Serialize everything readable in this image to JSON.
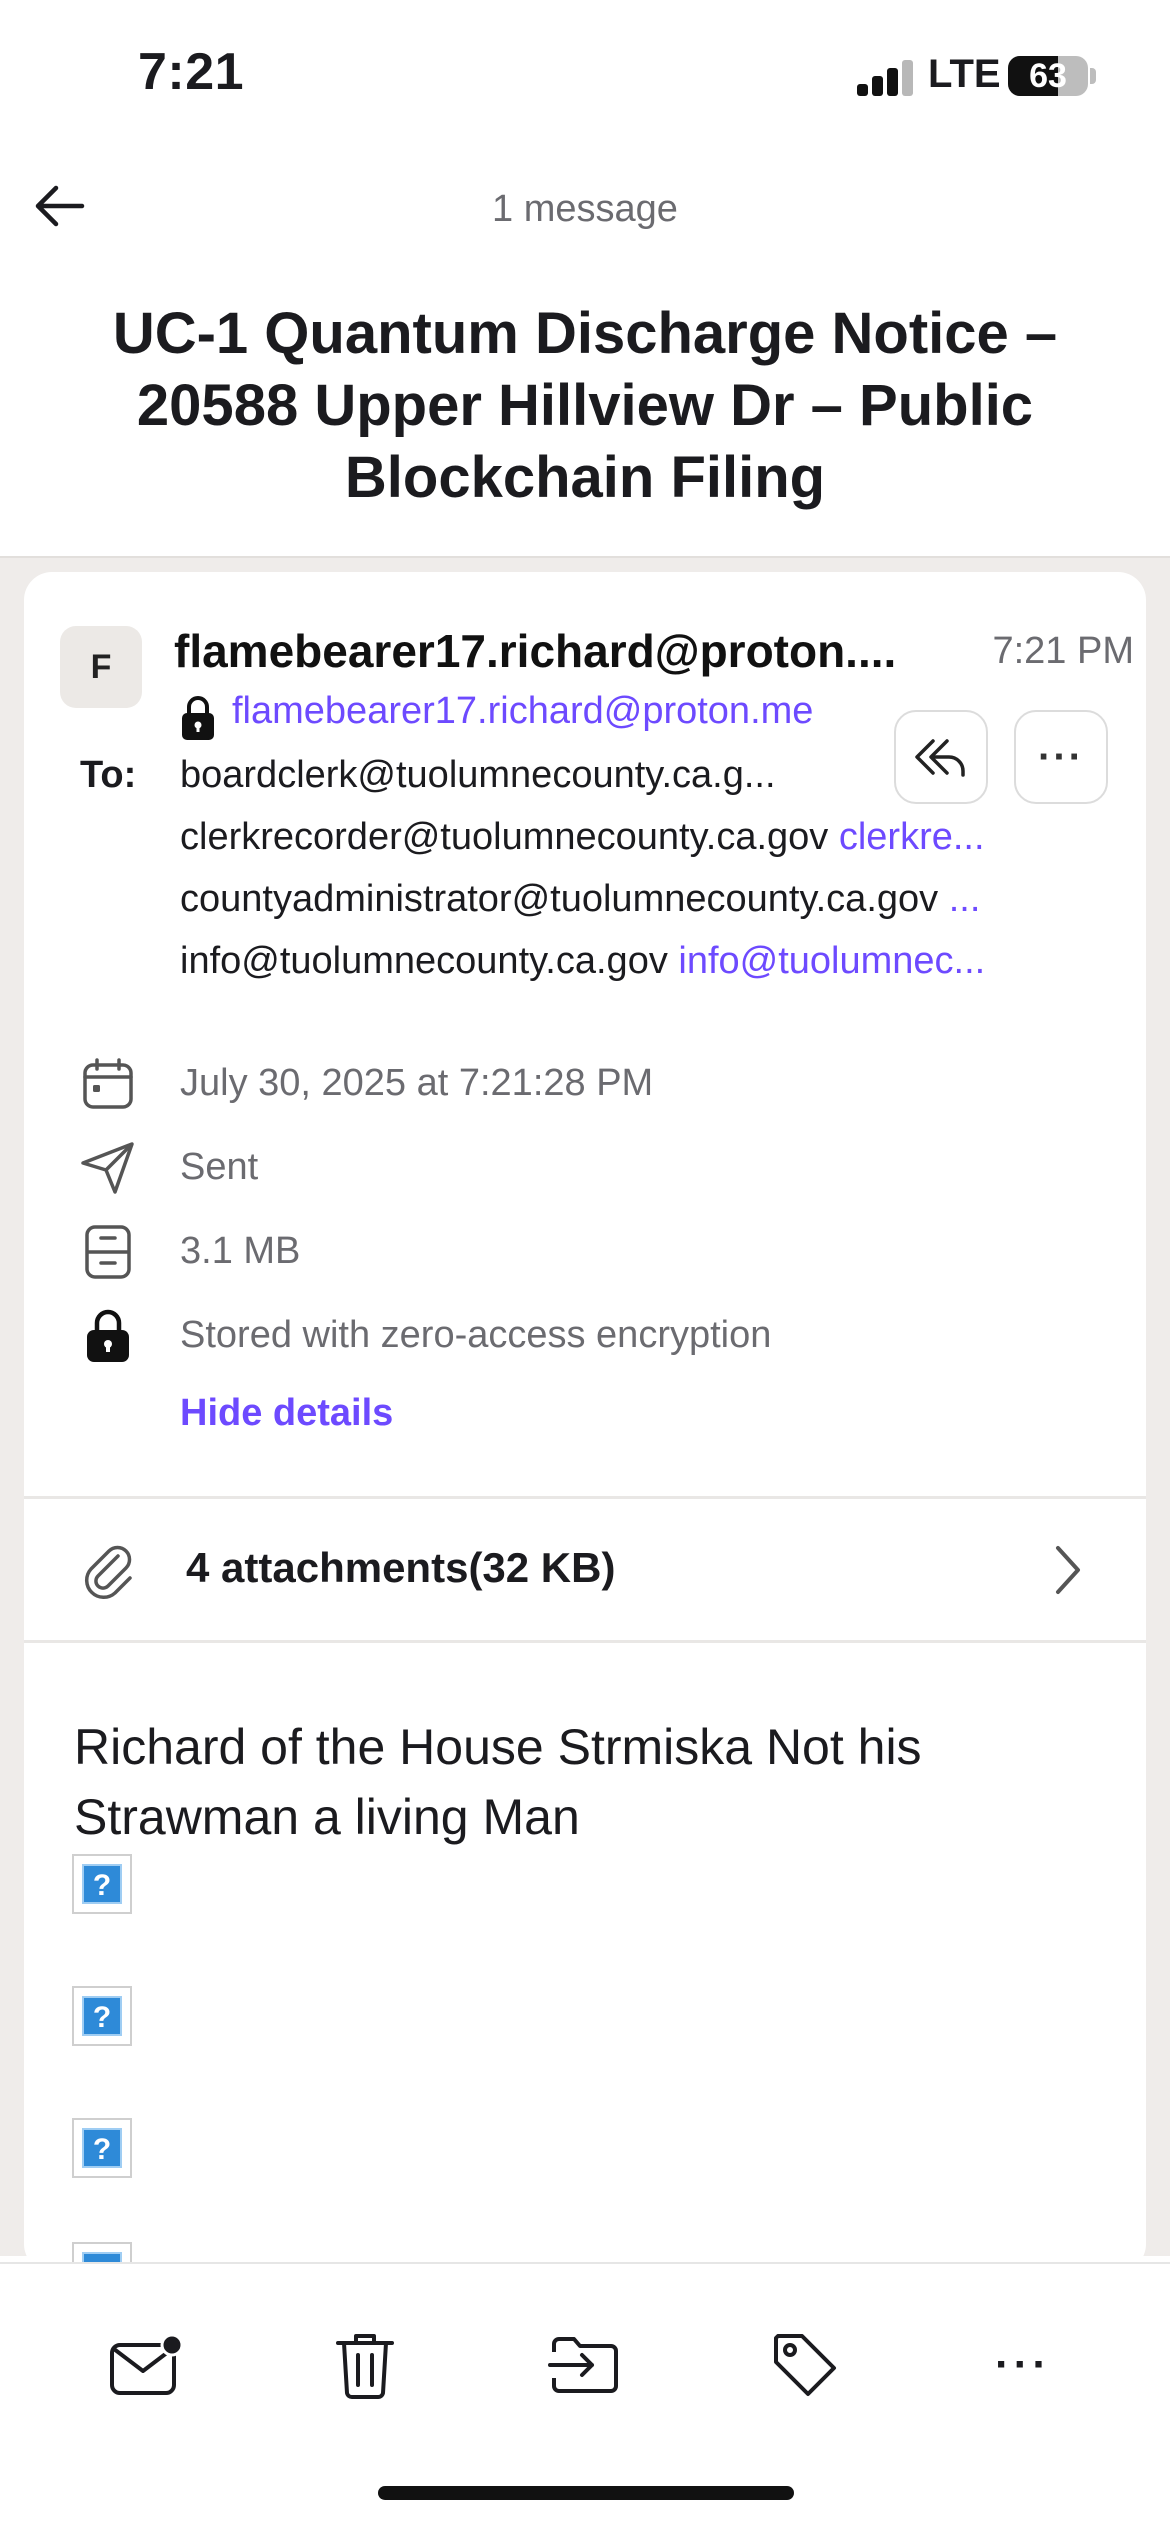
{
  "status_bar": {
    "time": "7:21",
    "network": "LTE",
    "battery": "63"
  },
  "header": {
    "message_count": "1 message",
    "subject": "UC-1 Quantum Discharge Notice – 20588 Upper Hillview Dr – Public Blockchain Filing"
  },
  "message": {
    "avatar_initial": "F",
    "sender_name": "flamebearer17.richard@proton....",
    "sender_address": "flamebearer17.richard@proton.me",
    "time": "7:21 PM",
    "to_label": "To:",
    "recipients": [
      {
        "address": "boardclerk@tuolumnecounty.ca.g...",
        "alt": ""
      },
      {
        "address": "clerkrecorder@tuolumnecounty.ca.gov",
        "alt": "clerkre..."
      },
      {
        "address": "countyadministrator@tuolumnecounty.ca.gov",
        "alt": "..."
      },
      {
        "address": "info@tuolumnecounty.ca.gov",
        "alt": "info@tuolumnec..."
      }
    ],
    "more_label": "···",
    "details": {
      "date": "July 30, 2025 at 7:21:28 PM",
      "folder": "Sent",
      "size": "3.1 MB",
      "encryption": "Stored with zero-access encryption",
      "hide_details": "Hide details"
    },
    "attachments": {
      "count_text": "4 attachments",
      "size_text": "(32 KB)"
    },
    "body": {
      "text": "Richard of the House Strmiska Not his Strawman a living Man",
      "image_placeholder": "?"
    }
  },
  "toolbar": {
    "more_label": "···"
  },
  "colors": {
    "accent": "#6d4aff",
    "muted": "#6b6b70",
    "band": "#efecea"
  }
}
